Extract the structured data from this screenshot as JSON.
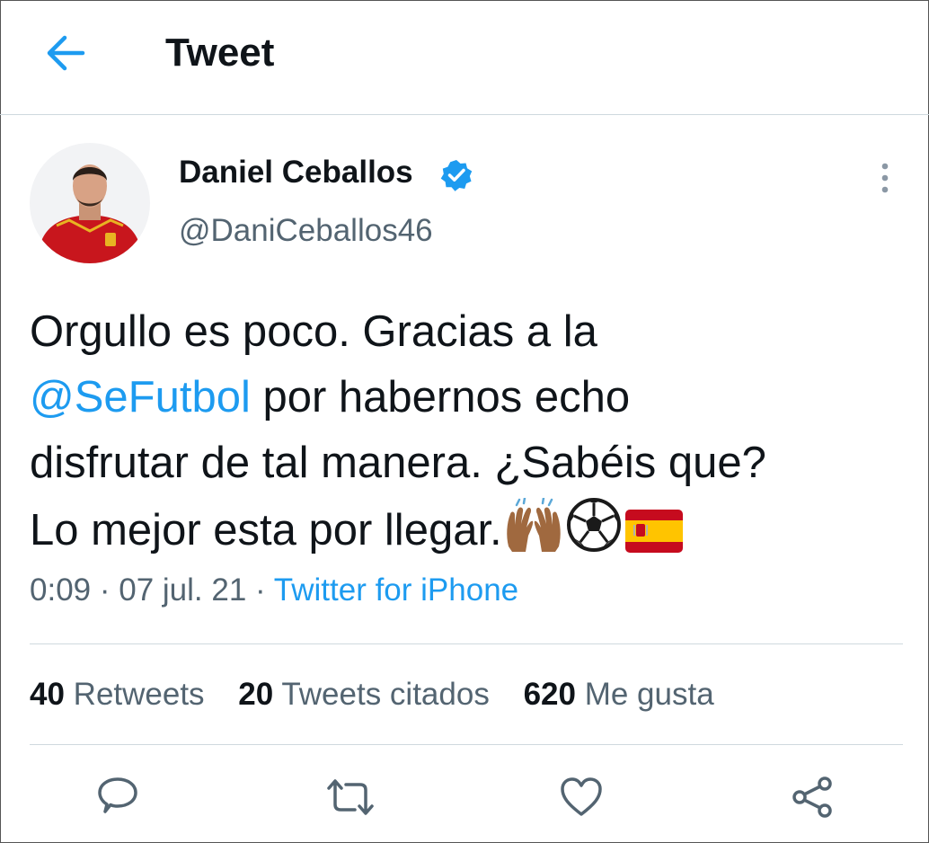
{
  "header": {
    "title": "Tweet"
  },
  "author": {
    "name": "Daniel Ceballos",
    "handle": "@DaniCeballos46"
  },
  "tweet": {
    "line1": "Orgullo es poco. Gracias a la",
    "mention": "@SeFutbol",
    "line2_rest": " por habernos echo",
    "line3": "disfrutar de tal manera. ¿Sabéis que?",
    "line4": "Lo mejor esta por llegar.",
    "emojis": [
      "raising-hands-emoji",
      "soccer-ball-emoji",
      "spain-flag-emoji"
    ]
  },
  "meta": {
    "time": "0:09",
    "date": "07 jul. 21",
    "source": "Twitter for iPhone",
    "separator": " · "
  },
  "stats": {
    "retweets_count": "40",
    "retweets_label": " Retweets",
    "quotes_count": "20",
    "quotes_label": " Tweets citados",
    "likes_count": "620",
    "likes_label": " Me gusta"
  },
  "colors": {
    "accent": "#1d9bf0",
    "text": "#0f1419",
    "secondary": "#536471",
    "divider": "#cfd9de"
  }
}
